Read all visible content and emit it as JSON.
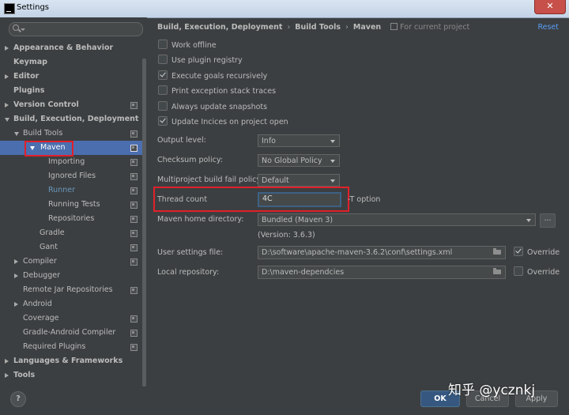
{
  "window": {
    "title": "Settings"
  },
  "search": {
    "placeholder": ""
  },
  "tree": [
    {
      "label": "Appearance & Behavior",
      "arrow": "right",
      "bold": true,
      "indent": 0,
      "scope": false
    },
    {
      "label": "Keymap",
      "arrow": "",
      "bold": true,
      "indent": 0,
      "scope": false
    },
    {
      "label": "Editor",
      "arrow": "right",
      "bold": true,
      "indent": 0,
      "scope": false
    },
    {
      "label": "Plugins",
      "arrow": "",
      "bold": true,
      "indent": 0,
      "scope": false
    },
    {
      "label": "Version Control",
      "arrow": "right",
      "bold": true,
      "indent": 0,
      "scope": true
    },
    {
      "label": "Build, Execution, Deployment",
      "arrow": "down",
      "bold": true,
      "indent": 0,
      "scope": false
    },
    {
      "label": "Build Tools",
      "arrow": "down",
      "bold": false,
      "indent": 1,
      "scope": true
    },
    {
      "label": "Maven",
      "arrow": "down",
      "bold": false,
      "indent": 2,
      "scope": true,
      "selected": true
    },
    {
      "label": "Importing",
      "arrow": "",
      "bold": false,
      "indent": 4,
      "scope": true
    },
    {
      "label": "Ignored Files",
      "arrow": "",
      "bold": false,
      "indent": 4,
      "scope": true
    },
    {
      "label": "Runner",
      "arrow": "",
      "bold": false,
      "indent": 4,
      "scope": true,
      "link": true
    },
    {
      "label": "Running Tests",
      "arrow": "",
      "bold": false,
      "indent": 4,
      "scope": true
    },
    {
      "label": "Repositories",
      "arrow": "",
      "bold": false,
      "indent": 4,
      "scope": true
    },
    {
      "label": "Gradle",
      "arrow": "",
      "bold": false,
      "indent": 3,
      "scope": true
    },
    {
      "label": "Gant",
      "arrow": "",
      "bold": false,
      "indent": 3,
      "scope": true
    },
    {
      "label": "Compiler",
      "arrow": "right",
      "bold": false,
      "indent": 1,
      "scope": true
    },
    {
      "label": "Debugger",
      "arrow": "right",
      "bold": false,
      "indent": 1,
      "scope": false
    },
    {
      "label": "Remote Jar Repositories",
      "arrow": "",
      "bold": false,
      "indent": 1,
      "scope": true
    },
    {
      "label": "Android",
      "arrow": "right",
      "bold": false,
      "indent": 1,
      "scope": false
    },
    {
      "label": "Coverage",
      "arrow": "",
      "bold": false,
      "indent": 1,
      "scope": true
    },
    {
      "label": "Gradle-Android Compiler",
      "arrow": "",
      "bold": false,
      "indent": 1,
      "scope": true
    },
    {
      "label": "Required Plugins",
      "arrow": "",
      "bold": false,
      "indent": 1,
      "scope": true
    },
    {
      "label": "Languages & Frameworks",
      "arrow": "right",
      "bold": true,
      "indent": 0,
      "scope": false
    },
    {
      "label": "Tools",
      "arrow": "right",
      "bold": true,
      "indent": 0,
      "scope": false
    }
  ],
  "breadcrumb": {
    "items": [
      "Build, Execution, Deployment",
      "Build Tools",
      "Maven"
    ],
    "separator": "›",
    "scope_note": "For current project",
    "reset": "Reset"
  },
  "checkboxes": [
    {
      "label": "Work offline",
      "checked": false
    },
    {
      "label": "Use plugin registry",
      "checked": false
    },
    {
      "label": "Execute goals recursively",
      "checked": true
    },
    {
      "label": "Print exception stack traces",
      "checked": false
    },
    {
      "label": "Always update snapshots",
      "checked": false
    },
    {
      "label": "Update Incices on project open",
      "checked": true
    }
  ],
  "fields": {
    "output_level": {
      "label": "Output level:",
      "value": "Info"
    },
    "checksum_policy": {
      "label": "Checksum policy:",
      "value": "No Global Policy"
    },
    "fail_policy": {
      "label": "Multiproject build fail policy:",
      "value": "Default"
    },
    "thread_count": {
      "label": "Thread count",
      "value": "4C",
      "hint": "-T option"
    },
    "maven_home": {
      "label": "Maven home directory:",
      "value": "Bundled (Maven 3)",
      "version": "(Version: 3.6.3)",
      "browse": "..."
    },
    "user_settings": {
      "label": "User settings file:",
      "value": "D:\\software\\apache-maven-3.6.2\\conf\\settings.xml",
      "override_label": "Override",
      "override": true
    },
    "local_repo": {
      "label": "Local repository:",
      "value": "D:\\maven-dependcies",
      "override_label": "Override",
      "override": false
    }
  },
  "buttons": {
    "help": "?",
    "ok": "OK",
    "cancel": "Cancel",
    "apply": "Apply"
  },
  "watermark": "知乎 @ycznkj",
  "colors": {
    "background": "#3c3f41",
    "selection": "#4b6eaf",
    "accent_link": "#589df6",
    "highlight_box": "#e0202a"
  }
}
